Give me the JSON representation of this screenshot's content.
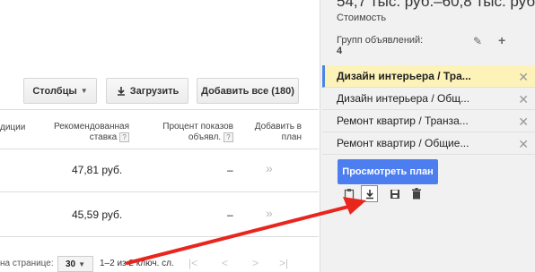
{
  "toolbar": {
    "columns_label": "Столбцы",
    "upload_label": "Загрузить",
    "add_all_label": "Добавить все (180)"
  },
  "table": {
    "headers": {
      "col_partial": "диции",
      "recommended_bid": "Рекомендованная ставка",
      "impression_share": "Процент показов объявл.",
      "add_to_plan": "Добавить в план",
      "help": "?"
    },
    "rows": [
      {
        "bid": "47,81 руб.",
        "share": "–",
        "add": "»"
      },
      {
        "bid": "45,59 руб.",
        "share": "–",
        "add": "»"
      }
    ]
  },
  "footer": {
    "per_page_label": "на странице:",
    "per_page_value": "30",
    "range_text": "1–2 из 2 ключ. сл.",
    "first": "|<",
    "prev": "<",
    "next": ">",
    "last": ">|"
  },
  "panel": {
    "cost_range": "54,7 тыс. руб.–60,8 тыс. руб.",
    "cost_label": "Стоимость",
    "groups_label": "Групп объявлений:",
    "groups_count": "4",
    "ad_groups": [
      {
        "name": "Дизайн интерьера / Тра...",
        "active": true
      },
      {
        "name": "Дизайн интерьера / Общ...",
        "active": false
      },
      {
        "name": "Ремонт квартир / Транза...",
        "active": false
      },
      {
        "name": "Ремонт квартир / Общие...",
        "active": false
      }
    ],
    "review_plan_label": "Просмотреть план"
  },
  "annotation": {
    "arrow_color": "#e8261e"
  }
}
